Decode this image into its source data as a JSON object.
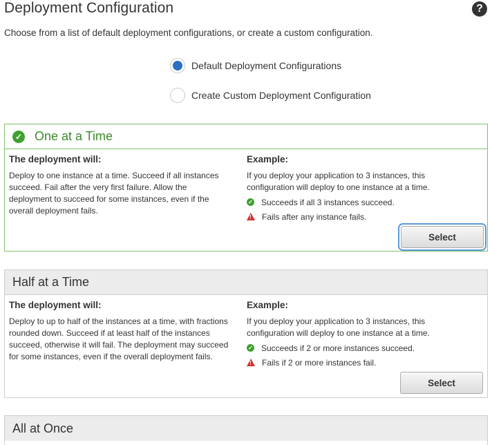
{
  "header": {
    "title": "Deployment Configuration",
    "help_icon": "question-circle-icon",
    "intro": "Choose from a list of default deployment configurations, or create a custom configuration."
  },
  "options": {
    "default_label": "Default Deployment Configurations",
    "custom_label": "Create Custom Deployment Configuration",
    "selected": "default"
  },
  "cards": [
    {
      "title": "One at a Time",
      "selected": true,
      "left_heading": "The deployment will:",
      "left_lines": [
        "Deploy to one instance at a time. Succeed if all instances",
        "succeed. Fail after the very first failure. Allow the",
        "deployment to succeed for some instances, even if the",
        "overall deployment fails."
      ],
      "right_heading": "Example:",
      "right_lines": [
        "If you deploy your application to 3 instances, this",
        "configuration will deploy to one instance at a time."
      ],
      "success_text": "Succeeds if all 3 instances succeed.",
      "fail_text": "Fails after any instance fails.",
      "button": "Select"
    },
    {
      "title": "Half at a Time",
      "selected": false,
      "left_heading": "The deployment will:",
      "left_lines": [
        "Deploy to up to half of the instances at a time, with fractions",
        "rounded down. Succeed if at least half of the instances",
        "succeed, otherwise it will fail. The deployment may succeed",
        "for some instances, even if the overall deployment fails."
      ],
      "right_heading": "Example:",
      "right_lines": [
        "If you deploy your application to 3 instances, this",
        "configuration will deploy to one instance at a time."
      ],
      "success_text": "Succeeds if 2 or more instances succeed.",
      "fail_text": "Fails if 2 or more instances fail.",
      "button": "Select"
    },
    {
      "title": "All at Once"
    }
  ],
  "colors": {
    "selected_green": "#3c8b2b",
    "radio_blue": "#2a6fc4",
    "error_red": "#d0312d"
  }
}
